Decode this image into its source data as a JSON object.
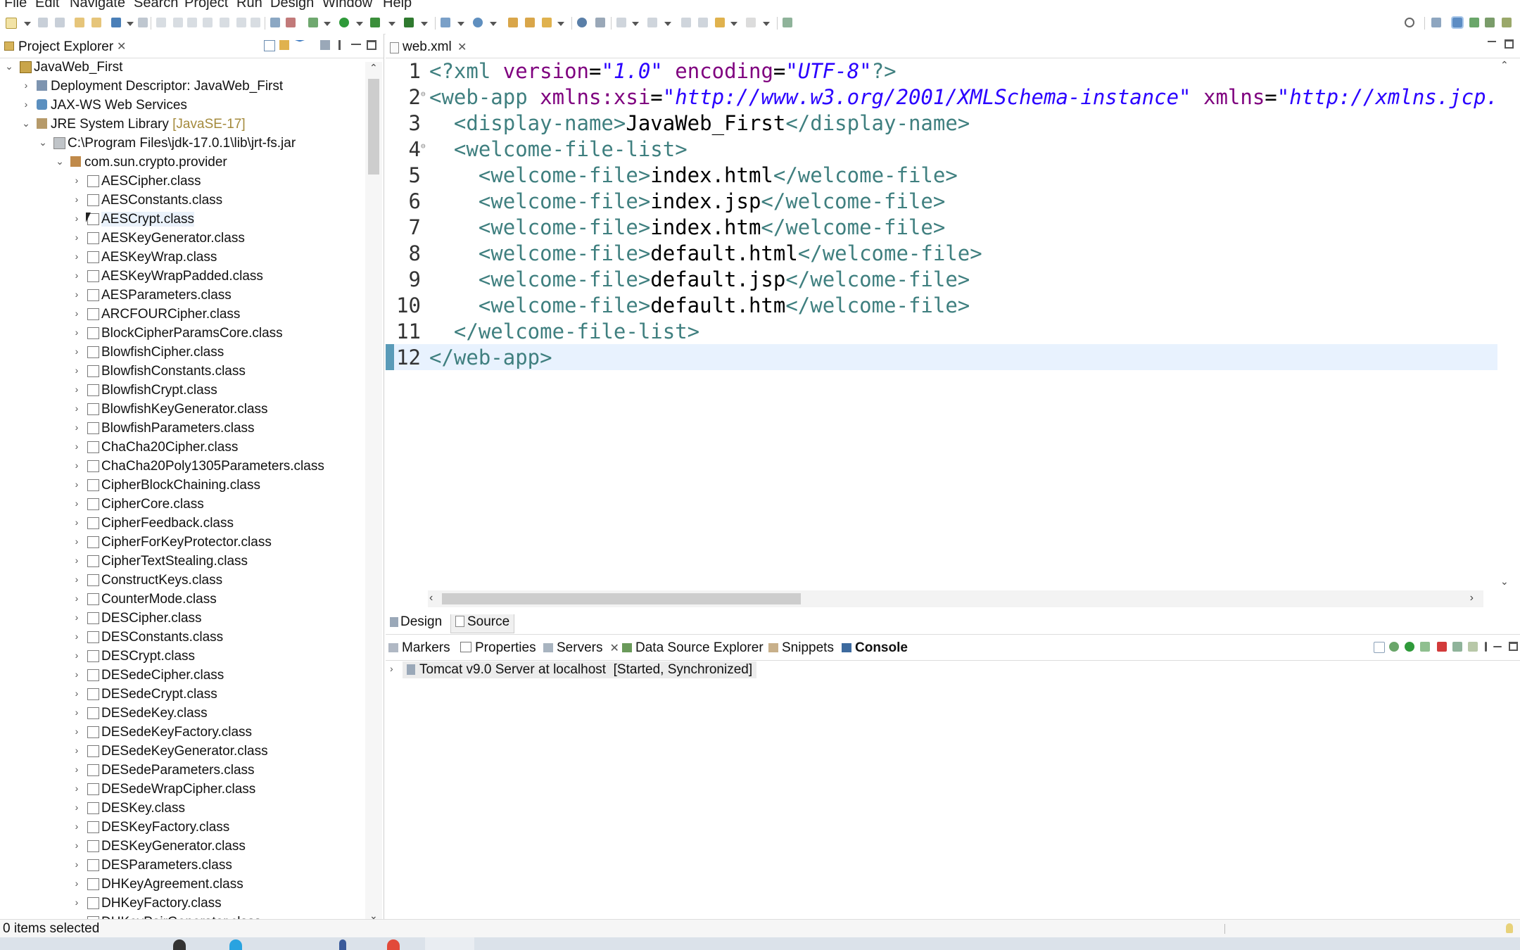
{
  "menu": [
    "File",
    "Edit",
    "Navigate",
    "Search",
    "Project",
    "Run",
    "Design",
    "Window",
    "Help"
  ],
  "project_explorer": {
    "title": "Project Explorer",
    "tree": [
      {
        "label": "JavaWeb_First",
        "level": 0,
        "twisty": "down",
        "icon": "project-icon"
      },
      {
        "label": "Deployment Descriptor: JavaWeb_First",
        "level": 1,
        "twisty": "right",
        "icon": "descriptor-icon"
      },
      {
        "label": "JAX-WS Web Services",
        "level": 1,
        "twisty": "right",
        "icon": "webservice-icon"
      },
      {
        "label": "JRE System Library",
        "decoration": "[JavaSE-17]",
        "level": 1,
        "twisty": "down",
        "icon": "library-icon"
      },
      {
        "label": "C:\\Program Files\\jdk-17.0.1\\lib\\jrt-fs.jar",
        "level": 2,
        "twisty": "down",
        "icon": "jar-icon"
      },
      {
        "label": "com.sun.crypto.provider",
        "level": 3,
        "twisty": "down",
        "icon": "package-icon"
      },
      {
        "label": "AESCipher.class",
        "level": 4,
        "twisty": "right",
        "icon": "class-file-icon"
      },
      {
        "label": "AESConstants.class",
        "level": 4,
        "twisty": "right",
        "icon": "class-file-icon"
      },
      {
        "label": "AESCrypt.class",
        "level": 4,
        "twisty": "right",
        "icon": "class-file-icon",
        "hover": true
      },
      {
        "label": "AESKeyGenerator.class",
        "level": 4,
        "twisty": "right",
        "icon": "class-file-icon"
      },
      {
        "label": "AESKeyWrap.class",
        "level": 4,
        "twisty": "right",
        "icon": "class-file-icon"
      },
      {
        "label": "AESKeyWrapPadded.class",
        "level": 4,
        "twisty": "right",
        "icon": "class-file-icon"
      },
      {
        "label": "AESParameters.class",
        "level": 4,
        "twisty": "right",
        "icon": "class-file-icon"
      },
      {
        "label": "ARCFOURCipher.class",
        "level": 4,
        "twisty": "right",
        "icon": "class-file-icon"
      },
      {
        "label": "BlockCipherParamsCore.class",
        "level": 4,
        "twisty": "right",
        "icon": "class-file-icon"
      },
      {
        "label": "BlowfishCipher.class",
        "level": 4,
        "twisty": "right",
        "icon": "class-file-icon"
      },
      {
        "label": "BlowfishConstants.class",
        "level": 4,
        "twisty": "right",
        "icon": "class-file-icon"
      },
      {
        "label": "BlowfishCrypt.class",
        "level": 4,
        "twisty": "right",
        "icon": "class-file-icon"
      },
      {
        "label": "BlowfishKeyGenerator.class",
        "level": 4,
        "twisty": "right",
        "icon": "class-file-icon"
      },
      {
        "label": "BlowfishParameters.class",
        "level": 4,
        "twisty": "right",
        "icon": "class-file-icon"
      },
      {
        "label": "ChaCha20Cipher.class",
        "level": 4,
        "twisty": "right",
        "icon": "class-file-icon"
      },
      {
        "label": "ChaCha20Poly1305Parameters.class",
        "level": 4,
        "twisty": "right",
        "icon": "class-file-icon"
      },
      {
        "label": "CipherBlockChaining.class",
        "level": 4,
        "twisty": "right",
        "icon": "class-file-icon"
      },
      {
        "label": "CipherCore.class",
        "level": 4,
        "twisty": "right",
        "icon": "class-file-icon"
      },
      {
        "label": "CipherFeedback.class",
        "level": 4,
        "twisty": "right",
        "icon": "class-file-icon"
      },
      {
        "label": "CipherForKeyProtector.class",
        "level": 4,
        "twisty": "right",
        "icon": "class-file-icon"
      },
      {
        "label": "CipherTextStealing.class",
        "level": 4,
        "twisty": "right",
        "icon": "class-file-icon"
      },
      {
        "label": "ConstructKeys.class",
        "level": 4,
        "twisty": "right",
        "icon": "class-file-icon"
      },
      {
        "label": "CounterMode.class",
        "level": 4,
        "twisty": "right",
        "icon": "class-file-icon"
      },
      {
        "label": "DESCipher.class",
        "level": 4,
        "twisty": "right",
        "icon": "class-file-icon"
      },
      {
        "label": "DESConstants.class",
        "level": 4,
        "twisty": "right",
        "icon": "class-file-icon"
      },
      {
        "label": "DESCrypt.class",
        "level": 4,
        "twisty": "right",
        "icon": "class-file-icon"
      },
      {
        "label": "DESedeCipher.class",
        "level": 4,
        "twisty": "right",
        "icon": "class-file-icon"
      },
      {
        "label": "DESedeCrypt.class",
        "level": 4,
        "twisty": "right",
        "icon": "class-file-icon"
      },
      {
        "label": "DESedeKey.class",
        "level": 4,
        "twisty": "right",
        "icon": "class-file-icon"
      },
      {
        "label": "DESedeKeyFactory.class",
        "level": 4,
        "twisty": "right",
        "icon": "class-file-icon"
      },
      {
        "label": "DESedeKeyGenerator.class",
        "level": 4,
        "twisty": "right",
        "icon": "class-file-icon"
      },
      {
        "label": "DESedeParameters.class",
        "level": 4,
        "twisty": "right",
        "icon": "class-file-icon"
      },
      {
        "label": "DESedeWrapCipher.class",
        "level": 4,
        "twisty": "right",
        "icon": "class-file-icon"
      },
      {
        "label": "DESKey.class",
        "level": 4,
        "twisty": "right",
        "icon": "class-file-icon"
      },
      {
        "label": "DESKeyFactory.class",
        "level": 4,
        "twisty": "right",
        "icon": "class-file-icon"
      },
      {
        "label": "DESKeyGenerator.class",
        "level": 4,
        "twisty": "right",
        "icon": "class-file-icon"
      },
      {
        "label": "DESParameters.class",
        "level": 4,
        "twisty": "right",
        "icon": "class-file-icon"
      },
      {
        "label": "DHKeyAgreement.class",
        "level": 4,
        "twisty": "right",
        "icon": "class-file-icon"
      },
      {
        "label": "DHKeyFactory.class",
        "level": 4,
        "twisty": "right",
        "icon": "class-file-icon"
      },
      {
        "label": "DHKeyPairGenerator.class",
        "level": 4,
        "twisty": "right",
        "icon": "class-file-icon"
      }
    ]
  },
  "editor": {
    "tab_label": "web.xml",
    "current_line": 12,
    "lines": [
      {
        "n": "1",
        "fold": false,
        "tokens": [
          [
            "tg",
            "<?xml "
          ],
          [
            "an",
            "version"
          ],
          [
            "txt",
            "="
          ],
          [
            "av",
            "\"1.0\""
          ],
          [
            "txt",
            " "
          ],
          [
            "an",
            "encoding"
          ],
          [
            "txt",
            "="
          ],
          [
            "av",
            "\"UTF-8\""
          ],
          [
            "tg",
            "?>"
          ]
        ]
      },
      {
        "n": "2",
        "fold": true,
        "tokens": [
          [
            "tg",
            "<web-app "
          ],
          [
            "an",
            "xmlns:xsi"
          ],
          [
            "txt",
            "="
          ],
          [
            "av",
            "\"http://www.w3.org/2001/XMLSchema-instance\""
          ],
          [
            "txt",
            " "
          ],
          [
            "an",
            "xmlns"
          ],
          [
            "txt",
            "="
          ],
          [
            "av",
            "\"http://xmlns.jcp.org/xml/ns/javaee\""
          ]
        ]
      },
      {
        "n": "3",
        "fold": false,
        "tokens": [
          [
            "txt",
            "  "
          ],
          [
            "tg",
            "<display-name>"
          ],
          [
            "txt",
            "JavaWeb_First"
          ],
          [
            "tg",
            "</display-name>"
          ]
        ]
      },
      {
        "n": "4",
        "fold": true,
        "tokens": [
          [
            "txt",
            "  "
          ],
          [
            "tg",
            "<welcome-file-list>"
          ]
        ]
      },
      {
        "n": "5",
        "fold": false,
        "tokens": [
          [
            "txt",
            "    "
          ],
          [
            "tg",
            "<welcome-file>"
          ],
          [
            "txt",
            "index.html"
          ],
          [
            "tg",
            "</welcome-file>"
          ]
        ]
      },
      {
        "n": "6",
        "fold": false,
        "tokens": [
          [
            "txt",
            "    "
          ],
          [
            "tg",
            "<welcome-file>"
          ],
          [
            "txt",
            "index.jsp"
          ],
          [
            "tg",
            "</welcome-file>"
          ]
        ]
      },
      {
        "n": "7",
        "fold": false,
        "tokens": [
          [
            "txt",
            "    "
          ],
          [
            "tg",
            "<welcome-file>"
          ],
          [
            "txt",
            "index.htm"
          ],
          [
            "tg",
            "</welcome-file>"
          ]
        ]
      },
      {
        "n": "8",
        "fold": false,
        "tokens": [
          [
            "txt",
            "    "
          ],
          [
            "tg",
            "<welcome-file>"
          ],
          [
            "txt",
            "default.html"
          ],
          [
            "tg",
            "</welcome-file>"
          ]
        ]
      },
      {
        "n": "9",
        "fold": false,
        "tokens": [
          [
            "txt",
            "    "
          ],
          [
            "tg",
            "<welcome-file>"
          ],
          [
            "txt",
            "default.jsp"
          ],
          [
            "tg",
            "</welcome-file>"
          ]
        ]
      },
      {
        "n": "10",
        "fold": false,
        "tokens": [
          [
            "txt",
            "    "
          ],
          [
            "tg",
            "<welcome-file>"
          ],
          [
            "txt",
            "default.htm"
          ],
          [
            "tg",
            "</welcome-file>"
          ]
        ]
      },
      {
        "n": "11",
        "fold": false,
        "tokens": [
          [
            "txt",
            "  "
          ],
          [
            "tg",
            "</welcome-file-list>"
          ]
        ]
      },
      {
        "n": "12",
        "fold": false,
        "tokens": [
          [
            "tg",
            "</web-app>"
          ]
        ]
      }
    ],
    "bottom_tabs": {
      "design": "Design",
      "source": "Source"
    }
  },
  "bottom_panel": {
    "tabs": [
      {
        "label": "Markers",
        "icon": "markers-icon"
      },
      {
        "label": "Properties",
        "icon": "properties-icon"
      },
      {
        "label": "Servers",
        "icon": "servers-icon",
        "closable": true
      },
      {
        "label": "Data Source Explorer",
        "icon": "datasource-icon"
      },
      {
        "label": "Snippets",
        "icon": "snippets-icon"
      },
      {
        "label": "Console",
        "icon": "console-icon",
        "active": true
      }
    ],
    "server": {
      "name": "Tomcat v9.0 Server at localhost",
      "state": "[Started, Synchronized]"
    }
  },
  "status": {
    "text": "0 items selected"
  },
  "colors": {
    "tag": "#3f7f7f",
    "attr_name": "#7f007f",
    "attr_value": "#2a00ff",
    "current_line_bg": "#e8f2fe",
    "library_decoration": "#a48a3c"
  }
}
